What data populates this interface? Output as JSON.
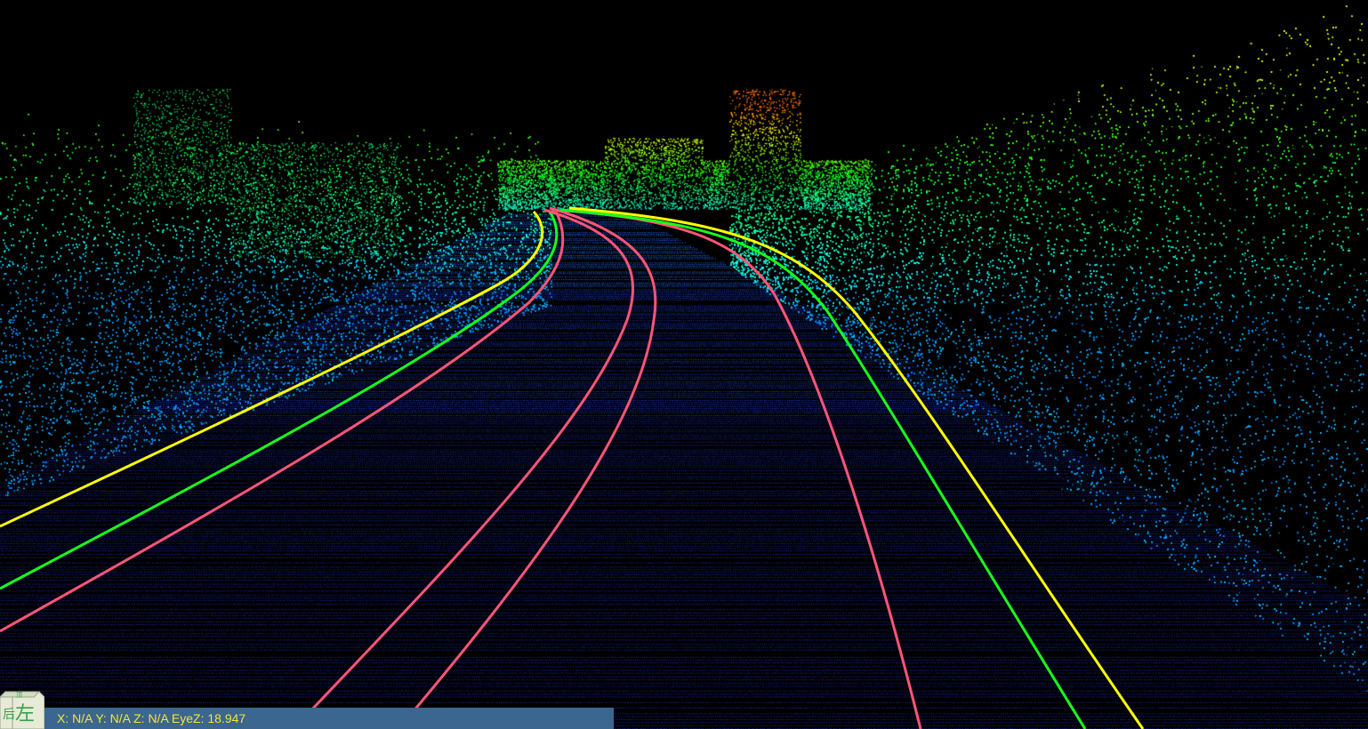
{
  "window": {
    "background": "#000000"
  },
  "scene": {
    "description_type": "lidar-point-cloud",
    "colormap": [
      "#2a0aa0",
      "#1a40ff",
      "#00c8ff",
      "#00ff80",
      "#a0ff00",
      "#ffd000",
      "#ff5a00"
    ],
    "lane_lines": [
      {
        "name": "left-outer-edge",
        "color": "#ffff00"
      },
      {
        "name": "left-lane-boundary",
        "color": "#19ff19"
      },
      {
        "name": "left-center-line",
        "color": "#ff5577"
      },
      {
        "name": "inner-left-line",
        "color": "#ff5577"
      },
      {
        "name": "inner-right-line",
        "color": "#ff5577"
      },
      {
        "name": "right-lane-boundary",
        "color": "#19ff19"
      },
      {
        "name": "right-outer-edge",
        "color": "#ffff00"
      }
    ]
  },
  "nav_cube": {
    "front_face_label": "左",
    "side_face_label": "后",
    "top_face_label": "顶"
  },
  "status_bar": {
    "text": "X: N/A Y: N/A Z: N/A EyeZ: 18.947",
    "background": "#3a6690",
    "text_color": "#f6e531"
  }
}
